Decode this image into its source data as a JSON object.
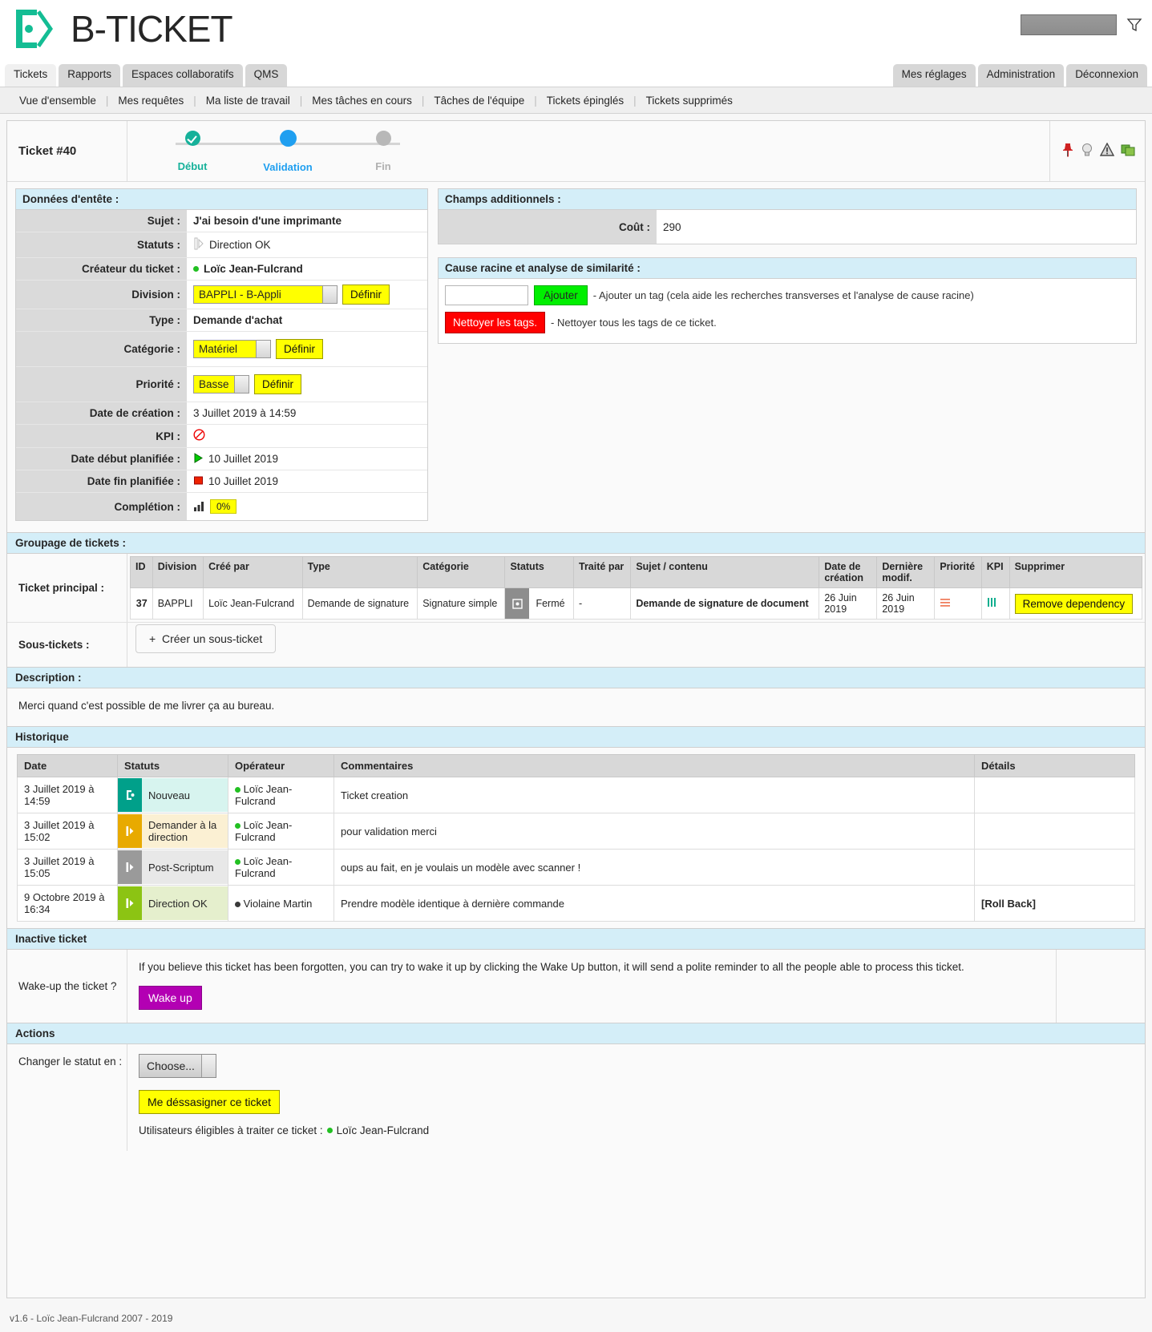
{
  "brand": {
    "name": "B-TICKET"
  },
  "header": {
    "search_value": "",
    "filter_icon": "funnel-icon"
  },
  "tabs": {
    "left": [
      "Tickets",
      "Rapports",
      "Espaces collaboratifs",
      "QMS"
    ],
    "right": [
      "Mes réglages",
      "Administration",
      "Déconnexion"
    ],
    "active": "Tickets"
  },
  "subnav": [
    "Vue d'ensemble",
    "Mes requêtes",
    "Ma liste de travail",
    "Mes tâches en cours",
    "Tâches de l'équipe",
    "Tickets épinglés",
    "Tickets supprimés"
  ],
  "ticket": {
    "id_label": "Ticket #40",
    "steps": [
      {
        "label": "Début",
        "state": "done"
      },
      {
        "label": "Validation",
        "state": "current"
      },
      {
        "label": "Fin",
        "state": "todo"
      }
    ],
    "icons": [
      "pin-icon",
      "lightbulb-icon",
      "warning-icon",
      "export-icon"
    ]
  },
  "header_data": {
    "title": "Données d'entête :",
    "subject_label": "Sujet :",
    "subject_value": "J'ai besoin d'une imprimante",
    "status_label": "Statuts :",
    "status_value": "Direction OK",
    "creator_label": "Créateur du ticket :",
    "creator_value": "Loïc Jean-Fulcrand",
    "division_label": "Division :",
    "division_value": "BAPPLI - B-Appli",
    "division_button": "Définir",
    "type_label": "Type :",
    "type_value": "Demande d'achat",
    "category_label": "Catégorie :",
    "category_value": "Matériel",
    "category_button": "Définir",
    "priority_label": "Priorité :",
    "priority_value": "Basse",
    "priority_button": "Définir",
    "created_label": "Date de création :",
    "created_value": "3 Juillet 2019 à 14:59",
    "kpi_label": "KPI :",
    "kpi_icon": "clock-red-icon",
    "start_label": "Date début planifiée :",
    "start_value": "10 Juillet 2019",
    "end_label": "Date fin planifiée :",
    "end_value": "10 Juillet 2019",
    "completion_label": "Complétion :",
    "completion_value": "0%"
  },
  "additional": {
    "title": "Champs additionnels :",
    "cost_label": "Coût :",
    "cost_value": "290"
  },
  "rootcause": {
    "title": "Cause racine et analyse de similarité :",
    "tag_input_value": "",
    "add_button": "Ajouter",
    "add_hint": "- Ajouter un tag (cela aide les recherches transverses et l'analyse de cause racine)",
    "clean_button": "Nettoyer les tags.",
    "clean_hint": "- Nettoyer tous les tags de ce ticket."
  },
  "grouping": {
    "title": "Groupage de tickets :",
    "main_label": "Ticket principal :",
    "columns": [
      "ID",
      "Division",
      "Créé par",
      "Type",
      "Catégorie",
      "Statuts",
      "Traité par",
      "Sujet / contenu",
      "Date de création",
      "Dernière modif.",
      "Priorité",
      "KPI",
      "Supprimer"
    ],
    "rows": [
      {
        "id": "37",
        "division": "BAPPLI",
        "created_by": "Loïc Jean-Fulcrand",
        "type": "Demande de signature",
        "category": "Signature simple",
        "status": "Fermé",
        "handled_by": "-",
        "subject": "Demande de signature de document",
        "created": "26 Juin 2019",
        "modified": "26 Juin 2019",
        "priority_icon": "priority-medium-icon",
        "kpi_icon": "kpi-green-icon",
        "delete_button": "Remove dependency"
      }
    ],
    "subtickets_label": "Sous-tickets :",
    "create_subticket": "Créer un sous-ticket"
  },
  "description": {
    "title": "Description :",
    "body": "Merci quand c'est possible de me livrer ça au bureau."
  },
  "history": {
    "title": "Historique",
    "columns": [
      "Date",
      "Statuts",
      "Opérateur",
      "Commentaires",
      "Détails"
    ],
    "rows": [
      {
        "date": "3 Juillet 2019 à 14:59",
        "status": "Nouveau",
        "status_color": "#00a08a",
        "status_bg": "#d7f4ef",
        "operator": "Loïc Jean-Fulcrand",
        "operator_dot": "green",
        "comment": "Ticket creation",
        "details": ""
      },
      {
        "date": "3 Juillet 2019 à 15:02",
        "status": "Demander à la direction",
        "status_color": "#e8aa00",
        "status_bg": "#fbf0d3",
        "operator": "Loïc Jean-Fulcrand",
        "operator_dot": "green",
        "comment": "pour validation merci",
        "details": ""
      },
      {
        "date": "3 Juillet 2019 à 15:05",
        "status": "Post-Scriptum",
        "status_color": "#9a9a9a",
        "status_bg": "#e8e8e8",
        "operator": "Loïc Jean-Fulcrand",
        "operator_dot": "green",
        "comment": "oups au fait, en je voulais un modèle avec scanner !",
        "details": ""
      },
      {
        "date": "9 Octobre 2019 à 16:34",
        "status": "Direction OK",
        "status_color": "#8cc413",
        "status_bg": "#e5efcd",
        "operator": "Violaine Martin",
        "operator_dot": "black",
        "comment": "Prendre modèle identique à dernière commande",
        "details": "[Roll Back]"
      }
    ]
  },
  "inactive": {
    "title": "Inactive ticket",
    "label": "Wake-up the ticket ?",
    "text": "If you believe this ticket has been forgotten, you can try to wake it up by clicking the Wake Up button, it will send a polite reminder to all the people able to process this ticket.",
    "button": "Wake up"
  },
  "actions": {
    "title": "Actions",
    "change_status_label": "Changer le statut en :",
    "select_value": "Choose...",
    "unassign_button": "Me déssasigner ce ticket",
    "eligible_label": "Utilisateurs éligibles à traiter ce ticket :",
    "eligible_user": "Loïc Jean-Fulcrand"
  },
  "footer": {
    "text": "v1.6 - Loïc Jean-Fulcrand 2007 - 2019"
  }
}
